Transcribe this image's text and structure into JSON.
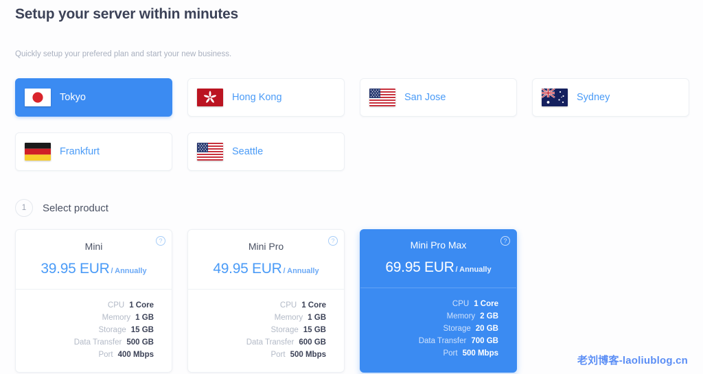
{
  "header": {
    "title": "Setup your server within minutes",
    "subtitle": "Quickly setup your prefered plan and start your new business."
  },
  "locations": [
    {
      "name": "Tokyo",
      "flag": "jp-flag-icon",
      "selected": true
    },
    {
      "name": "Hong Kong",
      "flag": "hk-flag-icon",
      "selected": false
    },
    {
      "name": "San Jose",
      "flag": "us-flag-icon",
      "selected": false
    },
    {
      "name": "Sydney",
      "flag": "au-flag-icon",
      "selected": false
    },
    {
      "name": "Frankfurt",
      "flag": "de-flag-icon",
      "selected": false
    },
    {
      "name": "Seattle",
      "flag": "us-flag-icon",
      "selected": false
    }
  ],
  "step": {
    "number": "1",
    "label": "Select product"
  },
  "spec_labels": [
    "CPU",
    "Memory",
    "Storage",
    "Data Transfer",
    "Port"
  ],
  "products": [
    {
      "name": "Mini",
      "price": "39.95 EUR",
      "period": "/ Annually",
      "selected": false,
      "help_icon": "question-mark-icon",
      "specs": {
        "cpu": "1 Core",
        "memory": "1 GB",
        "storage": "15 GB",
        "data_transfer": "500 GB",
        "port": "400 Mbps"
      }
    },
    {
      "name": "Mini Pro",
      "price": "49.95 EUR",
      "period": "/ Annually",
      "selected": false,
      "help_icon": "question-mark-icon",
      "specs": {
        "cpu": "1 Core",
        "memory": "1 GB",
        "storage": "15 GB",
        "data_transfer": "600 GB",
        "port": "500 Mbps"
      }
    },
    {
      "name": "Mini Pro Max",
      "price": "69.95 EUR",
      "period": "/ Annually",
      "selected": true,
      "help_icon": "question-mark-icon",
      "specs": {
        "cpu": "1 Core",
        "memory": "2 GB",
        "storage": "20 GB",
        "data_transfer": "700 GB",
        "port": "500 Mbps"
      }
    }
  ],
  "watermark": "老刘博客-laoliublog.cn",
  "colors": {
    "accent_blue": "#3b8bf2",
    "link_blue": "#4a9bf7",
    "text_dark": "#3c4257",
    "text_muted": "#a9b0bf",
    "background": "#fdfdfe"
  }
}
